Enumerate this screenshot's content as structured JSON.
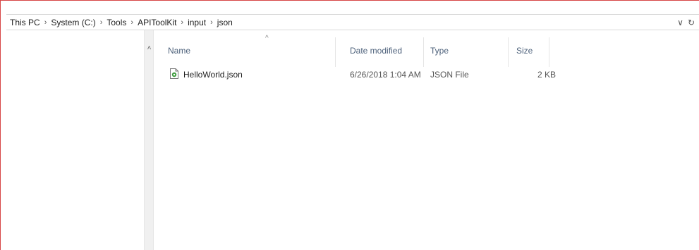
{
  "address_bar": {
    "breadcrumbs": [
      "This PC",
      "System (C:)",
      "Tools",
      "APIToolKit",
      "input",
      "json"
    ],
    "separator": "›",
    "dropdown_glyph": "∨",
    "refresh_glyph": "↻"
  },
  "nav_pane": {
    "scroll_up_glyph": "˄"
  },
  "columns": {
    "name": "Name",
    "date_modified": "Date modified",
    "type": "Type",
    "size": "Size",
    "sort_glyph": "^"
  },
  "files": [
    {
      "name": "HelloWorld.json",
      "date_modified": "6/26/2018 1:04 AM",
      "type": "JSON File",
      "size": "2 KB",
      "icon": "json-file-icon"
    }
  ],
  "colors": {
    "window_border": "#d64545",
    "header_text": "#4c607a",
    "icon_green": "#3a9a3a"
  }
}
